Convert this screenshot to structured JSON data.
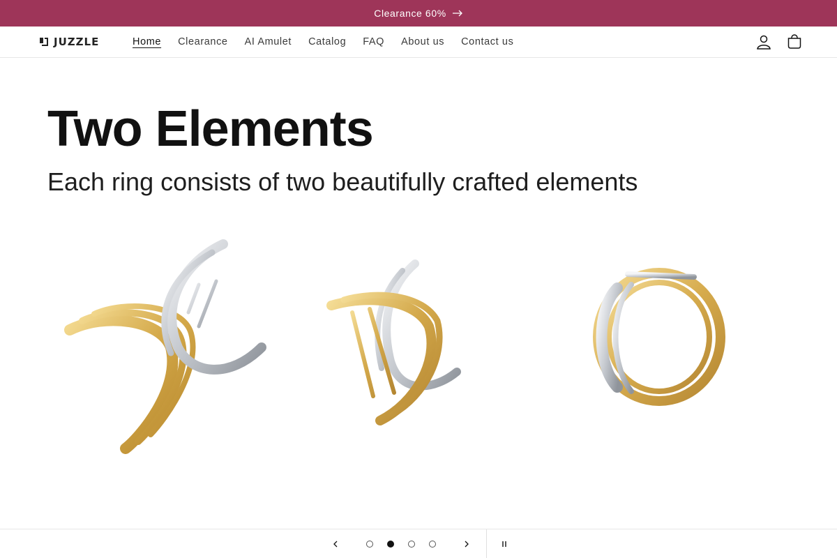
{
  "announcement": {
    "text": "Clearance 60%",
    "icon": "arrow-right-icon",
    "background": "#9e3559"
  },
  "header": {
    "logo_text": "JUZZLE",
    "nav": [
      {
        "label": "Home",
        "active": true
      },
      {
        "label": "Clearance"
      },
      {
        "label": "AI Amulet"
      },
      {
        "label": "Catalog"
      },
      {
        "label": "FAQ"
      },
      {
        "label": "About us"
      },
      {
        "label": "Contact us"
      }
    ],
    "icons": [
      "account-icon",
      "cart-icon"
    ]
  },
  "hero": {
    "title": "Two Elements",
    "subtitle": "Each ring consists of two beautifully crafted elements",
    "images": [
      "ring-separated-image",
      "ring-sliding-together-image",
      "ring-assembled-image"
    ]
  },
  "slider": {
    "slide_count": 4,
    "active_slide": 2,
    "controls": [
      "previous-slide-icon",
      "next-slide-icon",
      "pause-icon"
    ]
  },
  "colors": {
    "gold": "#d9b45a",
    "silver": "#c9ccd1"
  }
}
